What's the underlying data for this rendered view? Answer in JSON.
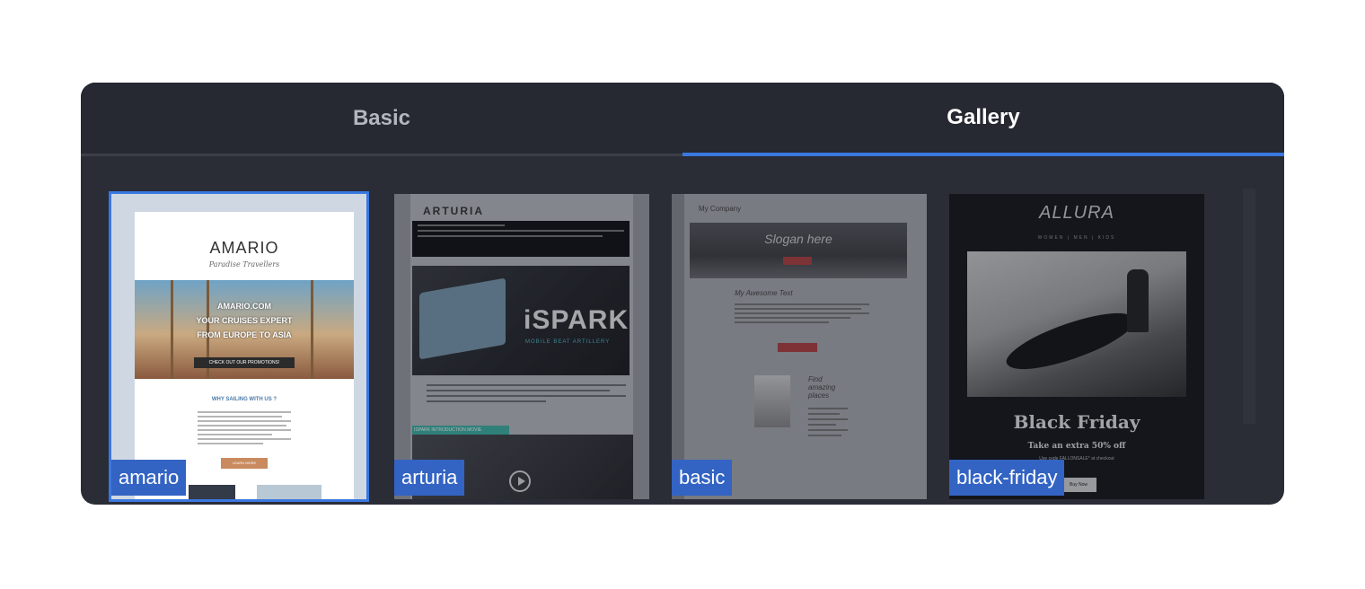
{
  "tabs": [
    {
      "label": "Basic",
      "active": false
    },
    {
      "label": "Gallery",
      "active": true
    }
  ],
  "accent_color": "#3a78e0",
  "templates": [
    {
      "id": "amario",
      "label": "amario",
      "selected": true,
      "preview": {
        "logo": "AMARIO",
        "tagline": "Paradise Travellers",
        "hero_site": "AMARIO.COM",
        "hero_line1": "YOUR CRUISES EXPERT",
        "hero_line2": "FROM EUROPE TO ASIA",
        "cta": "CHECK OUT OUR PROMOTIONS!",
        "section": "WHY SAILING WITH US ?",
        "button": "LEARN MORE"
      }
    },
    {
      "id": "arturia",
      "label": "arturia",
      "selected": false,
      "preview": {
        "logo": "ARTURIA",
        "headline": "iSPARK",
        "subheadline": "MOBILE BEAT ARTILLERY",
        "video_tag": "ISPARK INTRODUCTION MOVIE"
      }
    },
    {
      "id": "basic",
      "label": "basic",
      "selected": false,
      "preview": {
        "company": "My Company",
        "hero": "Slogan here",
        "title": "My Awesome Text",
        "side_title": "Find amazing places"
      }
    },
    {
      "id": "black-friday",
      "label": "black-friday",
      "selected": false,
      "preview": {
        "logo": "ALLURA",
        "nav": "WOMEN | MEN | KIDS",
        "headline": "Black Friday",
        "offer": "Take an extra 50% off",
        "note": "Use code FALLONSALE* at checkout",
        "button": "Buy Now"
      }
    }
  ]
}
